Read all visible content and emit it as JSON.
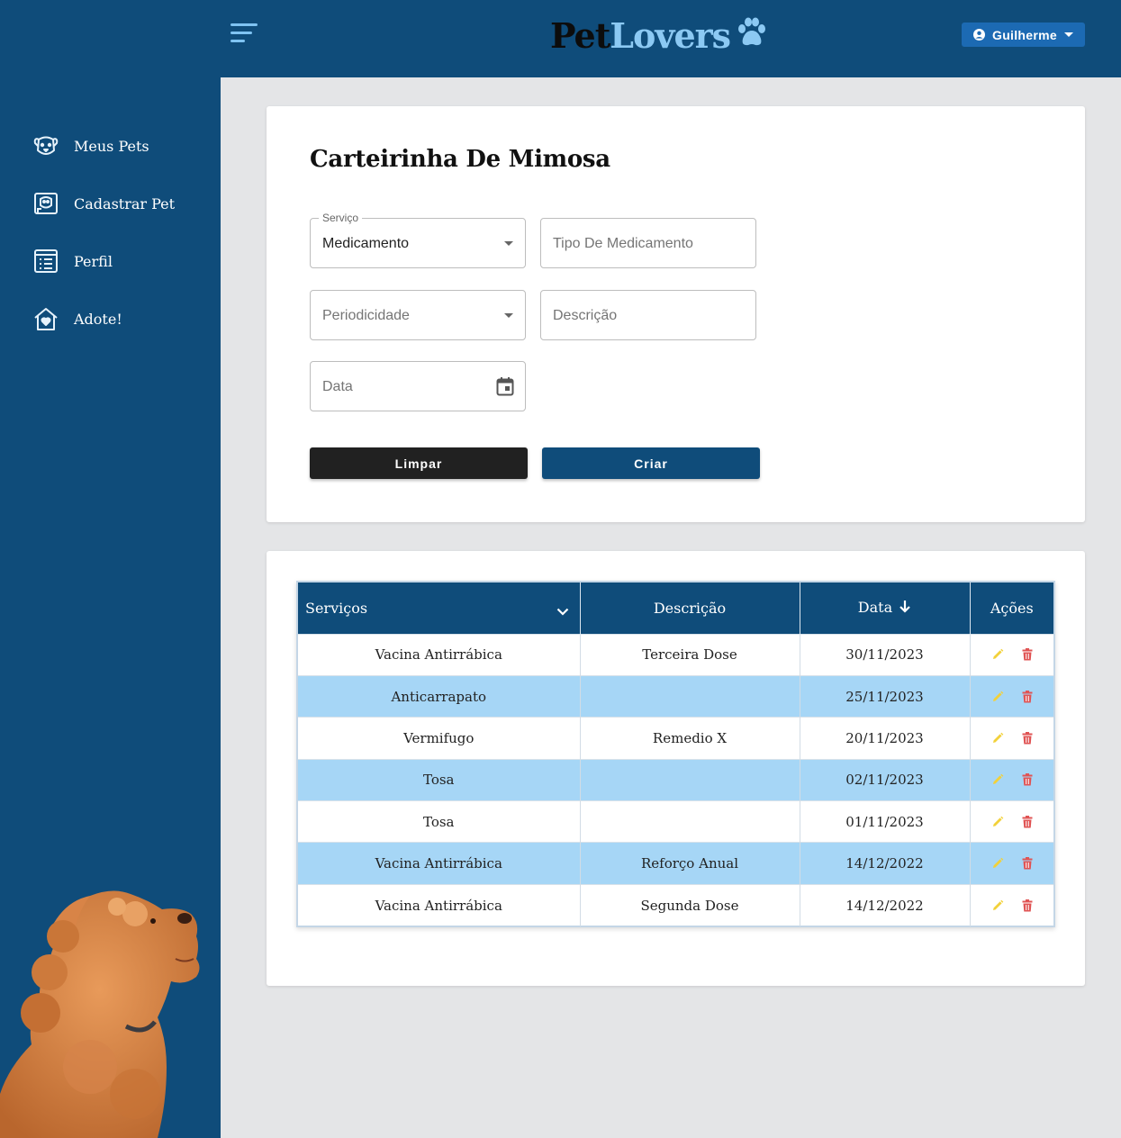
{
  "app": {
    "logo_part1": "Pet",
    "logo_part2": "Lovers",
    "user_name": "Guilherme"
  },
  "sidebar": {
    "items": [
      {
        "label": "Meus Pets",
        "icon": "dog-face-icon"
      },
      {
        "label": "Cadastrar Pet",
        "icon": "pet-photo-icon"
      },
      {
        "label": "Perfil",
        "icon": "profile-card-icon"
      },
      {
        "label": "Adote!",
        "icon": "heart-house-icon"
      }
    ]
  },
  "form": {
    "title": "Carteirinha De Mimosa",
    "servico_label": "Serviço",
    "servico_value": "Medicamento",
    "tipo_placeholder": "Tipo De Medicamento",
    "periodicidade_placeholder": "Periodicidade",
    "descricao_placeholder": "Descrição",
    "data_placeholder": "Data",
    "clear_label": "Limpar",
    "create_label": "Criar"
  },
  "table": {
    "headers": {
      "servicos": "Serviços",
      "descricao": "Descrição",
      "data": "Data",
      "acoes": "Ações"
    },
    "rows": [
      {
        "servico": "Vacina Antirrábica",
        "descricao": "Terceira Dose",
        "data": "30/11/2023"
      },
      {
        "servico": "Anticarrapato",
        "descricao": "",
        "data": "25/11/2023"
      },
      {
        "servico": "Vermifugo",
        "descricao": "Remedio X",
        "data": "20/11/2023"
      },
      {
        "servico": "Tosa",
        "descricao": "",
        "data": "02/11/2023"
      },
      {
        "servico": "Tosa",
        "descricao": "",
        "data": "01/11/2023"
      },
      {
        "servico": "Vacina Antirrábica",
        "descricao": "Reforço Anual",
        "data": "14/12/2022"
      },
      {
        "servico": "Vacina Antirrábica",
        "descricao": "Segunda Dose",
        "data": "14/12/2022"
      }
    ]
  },
  "colors": {
    "primary": "#0f4c7a",
    "accent_light": "#8cc9f3",
    "row_alt": "#a6d6f6",
    "edit_icon": "#f2d13a",
    "delete_icon": "#e05454"
  }
}
